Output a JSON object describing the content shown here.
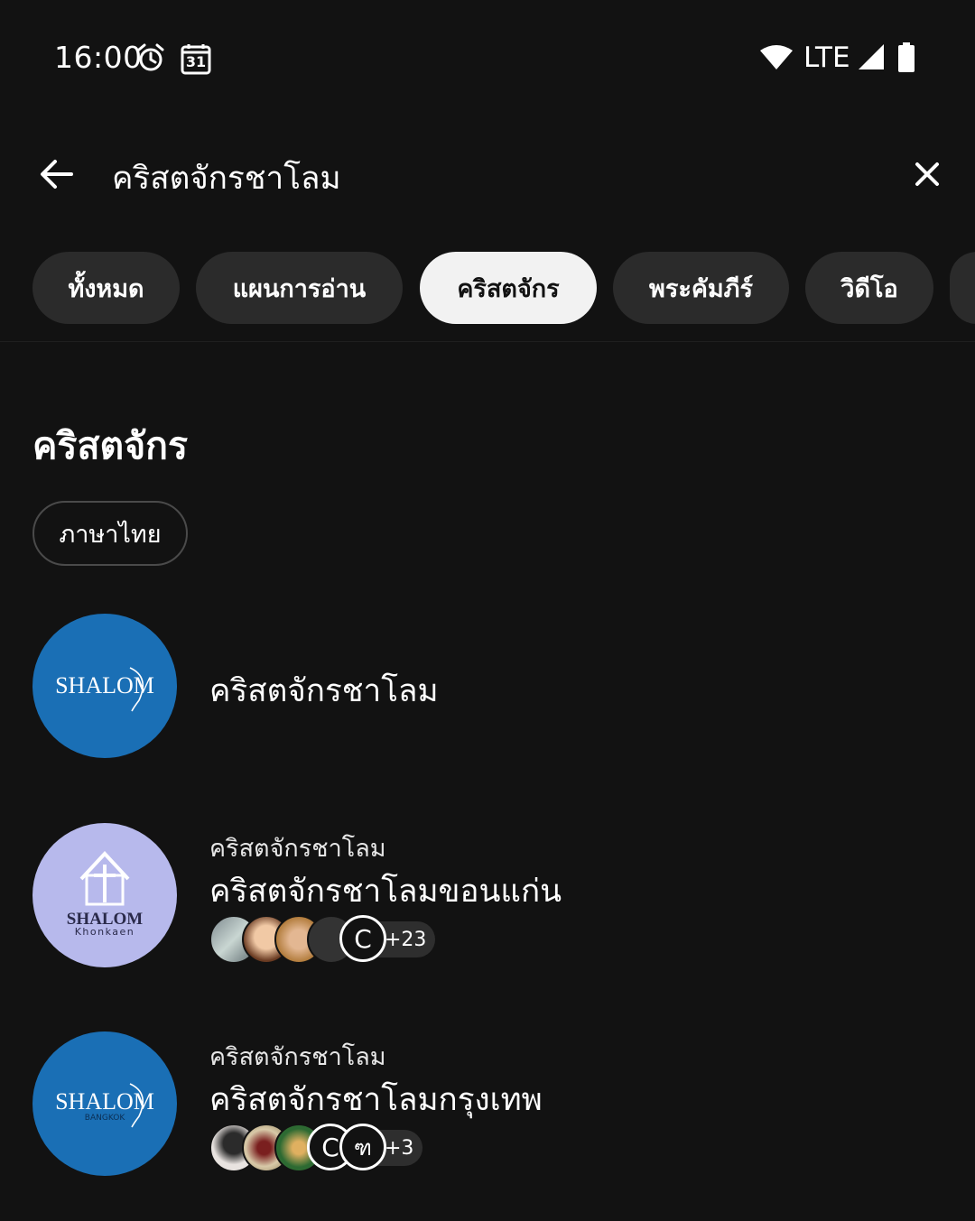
{
  "status_bar": {
    "time": "16:00",
    "calendar_day": "31",
    "network": "LTE",
    "icons": [
      "alarm-icon",
      "calendar-icon",
      "wifi-icon",
      "signal-icon",
      "battery-icon"
    ]
  },
  "search": {
    "query": "คริสตจักรชาโลม",
    "back_icon": "arrow-back-icon",
    "clear_icon": "close-icon"
  },
  "filters": {
    "chips": [
      {
        "label": "ทั้งหมด",
        "active": false
      },
      {
        "label": "แผนการอ่าน",
        "active": false
      },
      {
        "label": "คริสตจักร",
        "active": true
      },
      {
        "label": "พระคัมภีร์",
        "active": false
      },
      {
        "label": "วิดีโอ",
        "active": false
      }
    ]
  },
  "section": {
    "title": "คริสตจักร",
    "language_chip": "ภาษาไทย"
  },
  "results": [
    {
      "title": "คริสตจักรชาโลม",
      "logo": {
        "text": "SHALOM",
        "caption": "",
        "bg": "#1a6fb5"
      }
    },
    {
      "subtitle": "คริสตจักรชาโลม",
      "title": "คริสตจักรชาโลมขอนแก่น",
      "logo": {
        "text": "SHALOM",
        "caption": "Khonkaen",
        "bg": "#b7b9ec"
      },
      "member_more": "+23",
      "member_last_letter": "C"
    },
    {
      "subtitle": "คริสตจักรชาโลม",
      "title": "คริสตจักรชาโลมกรุงเทพ",
      "logo": {
        "text": "SHALOM",
        "caption": "BANGKOK",
        "bg": "#1a6fb5"
      },
      "member_more": "+3",
      "member_letters": [
        "C",
        "ฑ"
      ]
    }
  ],
  "colors": {
    "background": "#121212",
    "chip_bg": "#2b2b2b",
    "chip_active_bg": "#f2f2f2",
    "logo_blue": "#1a6fb5",
    "logo_lavender": "#b7b9ec"
  }
}
